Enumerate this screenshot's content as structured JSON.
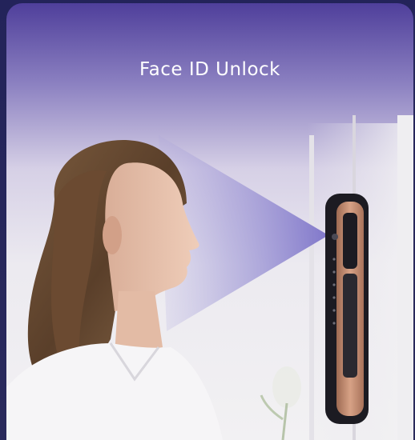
{
  "header": {
    "title": "Face ID Unlock"
  },
  "illustration": {
    "subject": "woman-profile",
    "device": "face-recognition-smart-lock",
    "colors": {
      "top": "#4f3f9b",
      "scan_beam": "#7b72c9",
      "lock_accent": "#c68a6e",
      "lock_body": "#1c1b22"
    }
  }
}
